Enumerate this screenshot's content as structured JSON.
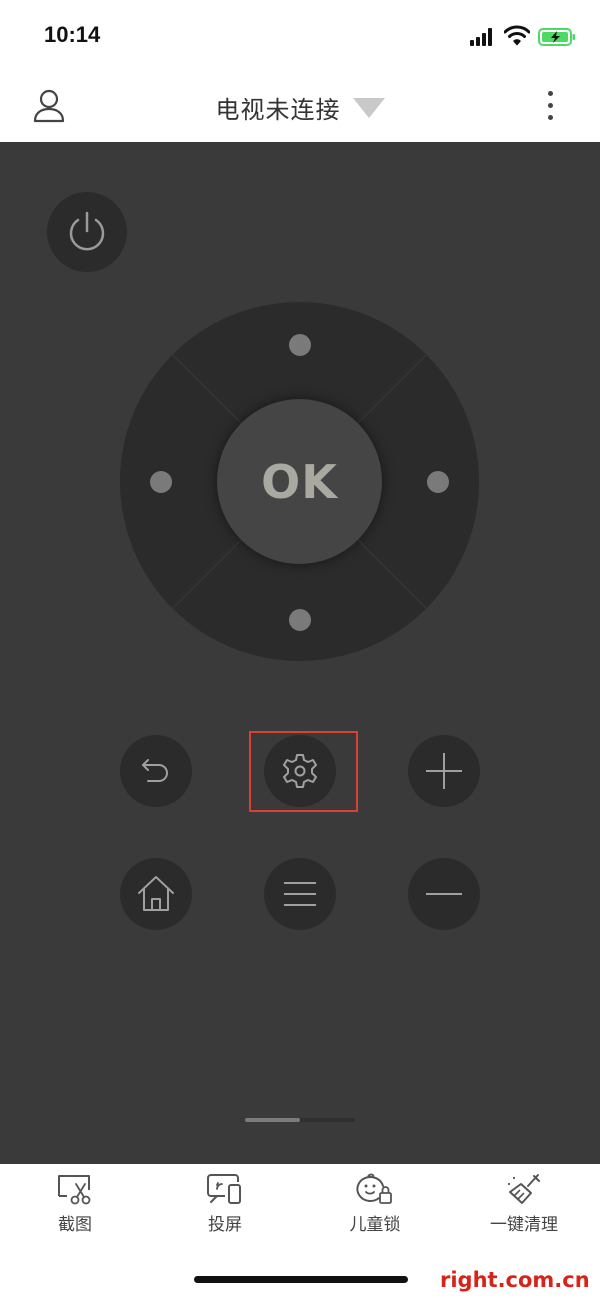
{
  "status_bar": {
    "time": "10:14"
  },
  "header": {
    "title": "电视未连接"
  },
  "remote": {
    "ok_label": "OK"
  },
  "toolbar": {
    "items": [
      {
        "label": "截图",
        "icon": "screenshot-icon"
      },
      {
        "label": "投屏",
        "icon": "cast-icon"
      },
      {
        "label": "儿童锁",
        "icon": "child-lock-icon"
      },
      {
        "label": "一键清理",
        "icon": "clean-icon"
      }
    ]
  },
  "watermark": "right.com.cn",
  "colors": {
    "remote_bg": "#3a3a3a",
    "button_bg": "#2b2b2b",
    "highlight": "#d8432f",
    "battery": "#4cd964",
    "watermark": "#d8231a"
  }
}
